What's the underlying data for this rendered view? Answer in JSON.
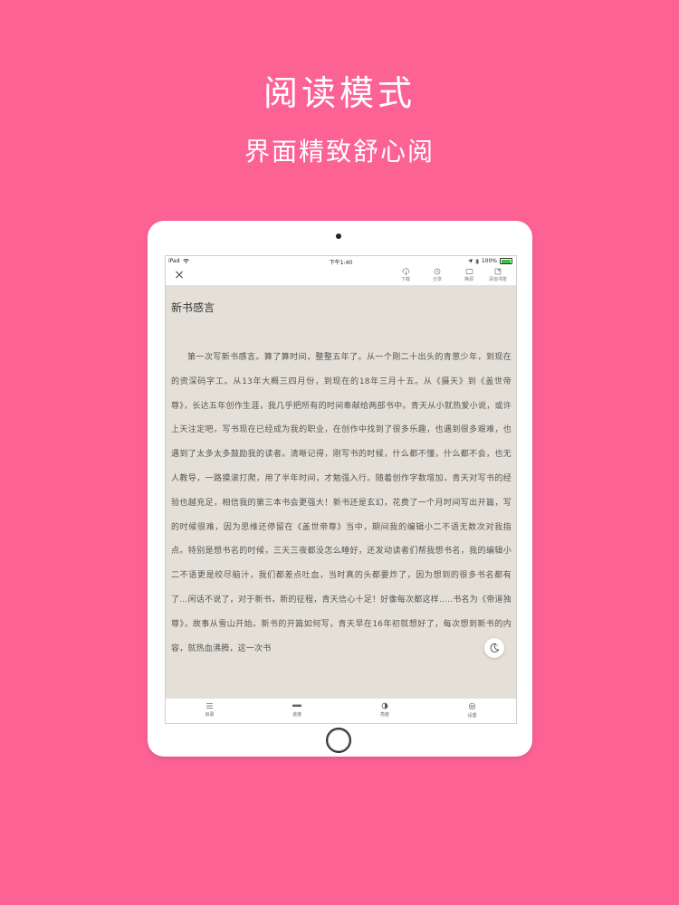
{
  "promo": {
    "headline": "阅读模式",
    "subline": "界面精致舒心阅"
  },
  "status_bar": {
    "device": "iPad",
    "time": "下午1:40",
    "battery": "100%",
    "battery_level": 1.0
  },
  "toolbar": {
    "items": [
      {
        "icon": "download-icon",
        "label": "下载"
      },
      {
        "icon": "share-icon",
        "label": "分享"
      },
      {
        "icon": "source-icon",
        "label": "换源"
      },
      {
        "icon": "bookmark-icon",
        "label": "添加书签"
      }
    ]
  },
  "reader": {
    "chapter_title": "新书感言",
    "body": "第一次写新书感言。算了算时间，整整五年了。从一个刚二十出头的青葱少年，到现在的资深码字工。从13年大概三四月份，到现在的18年三月十五。从《摄天》到《盖世帝尊》，长达五年创作生涯，我几乎把所有的时间奉献给两部书中。青天从小就热爱小说，或许上天注定吧，写书现在已经成为我的职业，在创作中找到了很多乐趣，也遇到很多艰难，也遇到了太多太多鼓励我的读者。清晰记得，刚写书的时候，什么都不懂，什么都不会，也无人教导，一路摸滚打爬，用了半年时间，才勉强入行。随着创作字数增加，青天对写书的经验也越充足，相信我的第三本书会更强大！新书还是玄幻，花费了一个月时间写出开篇，写的时候很难，因为思维还停留在《盖世帝尊》当中，期间我的编辑小二不语无数次对我指点。特别是想书名的时候，三天三夜都没怎么睡好，还发动读者们帮我想书名，我的编辑小二不语更是绞尽脑汁，我们都差点吐血，当时真的头都要炸了，因为想到的很多书名都有了...闲话不说了，对于新书，新的征程，青天信心十足！好像每次都这样.....书名为《帝道独尊》，故事从雪山开始。新书的开篇如何写，青天早在16年初就想好了，每次想到新书的内容，就热血沸腾，这一次书"
  },
  "bottom_bar": {
    "tabs": [
      {
        "icon": "list-icon",
        "label": "目录"
      },
      {
        "icon": "progress-icon",
        "label": "进度"
      },
      {
        "icon": "brightness-icon",
        "label": "亮度"
      },
      {
        "icon": "settings-icon",
        "label": "设置"
      }
    ]
  },
  "colors": {
    "background": "#fd6295",
    "reader_bg": "#e4e0d7",
    "text": "#555555",
    "toolbar_icon": "#777777"
  }
}
